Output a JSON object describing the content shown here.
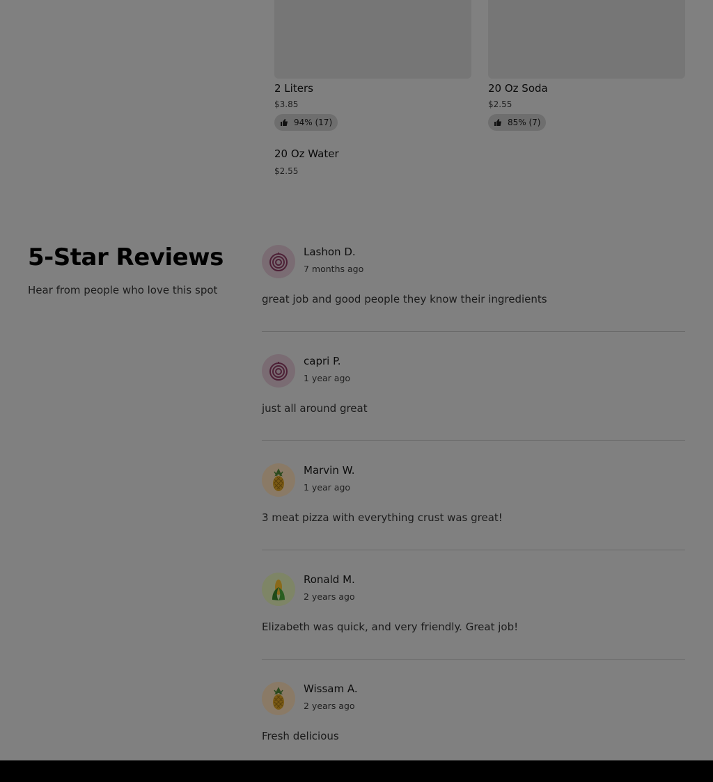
{
  "menu_items": [
    {
      "name": "2 Liters",
      "price": "$3.85",
      "rating": "94% (17)"
    },
    {
      "name": "20 Oz Soda",
      "price": "$2.55",
      "rating": "85% (7)"
    },
    {
      "name": "20 Oz Water",
      "price": "$2.55"
    }
  ],
  "reviews_section": {
    "title": "5-Star Reviews",
    "subtitle": "Hear from people who love this spot"
  },
  "reviews": [
    {
      "name": "Lashon D.",
      "time": "7 months ago",
      "text": "great job and good people they know their ingredients",
      "avatar_icon": "onion-icon",
      "avatar_bg": "#7a6c73"
    },
    {
      "name": "capri P.",
      "time": "1 year ago",
      "text": "just all around great",
      "avatar_icon": "onion-icon",
      "avatar_bg": "#7a6c73"
    },
    {
      "name": "Marvin W.",
      "time": "1 year ago",
      "text": "3 meat pizza with everything crust was great!",
      "avatar_icon": "pineapple-icon",
      "avatar_bg": "#8a7a66"
    },
    {
      "name": "Ronald M.",
      "time": "2 years ago",
      "text": "Elizabeth was quick, and very friendly. Great job!",
      "avatar_icon": "corn-icon",
      "avatar_bg": "#7e8566"
    },
    {
      "name": "Wissam A.",
      "time": "2 years ago",
      "text": "Fresh delicious",
      "avatar_icon": "pineapple-icon",
      "avatar_bg": "#8a7a66"
    }
  ]
}
